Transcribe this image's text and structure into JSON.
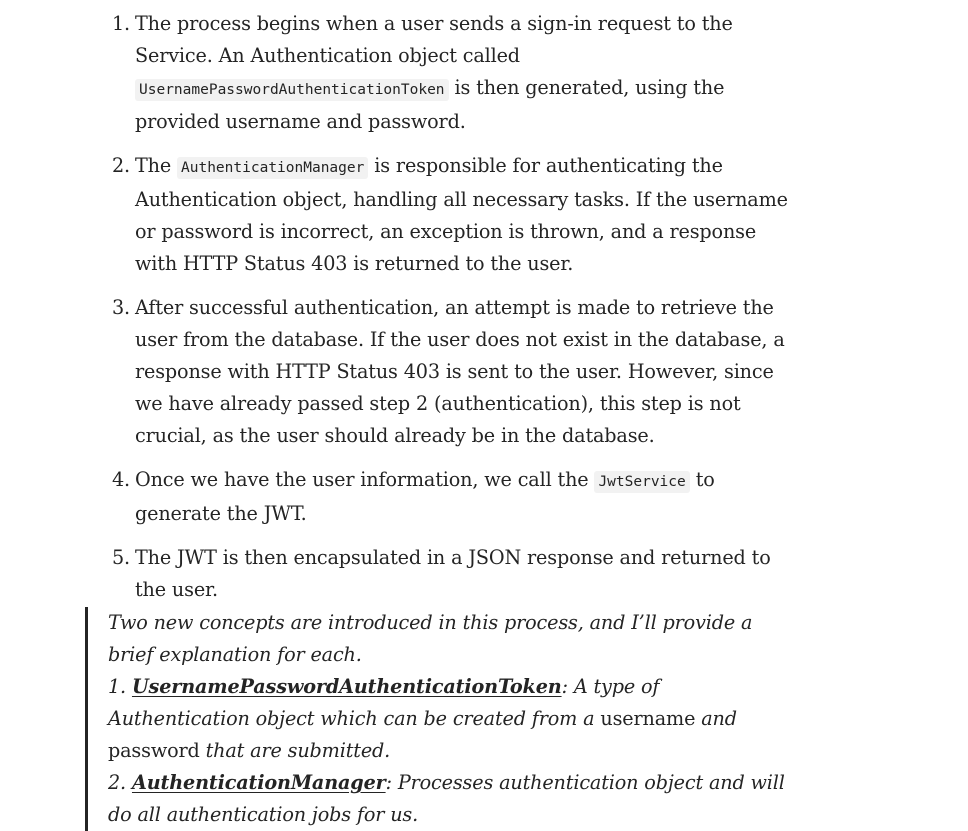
{
  "steps": [
    {
      "number": "1.",
      "text_1": "The process begins when a user sends a sign-in request to the Service. An Authentication object called ",
      "code_1": "UsernamePasswordAuthenticationToken",
      "text_2": " is then generated, using the provided username and password."
    },
    {
      "number": "2.",
      "text_1": "The ",
      "code_1": "AuthenticationManager",
      "text_2": " is responsible for authenticating the Authentication object, handling all necessary tasks. If the username or password is incorrect, an exception is thrown, and a response with HTTP Status 403 is returned to the user."
    },
    {
      "number": "3.",
      "text_1": "After successful authentication, an attempt is made to retrieve the user from the database. If the user does not exist in the database, a response with HTTP Status 403 is sent to the user. However, since we have already passed step 2 (authentication), this step is not crucial, as the user should already be in the database."
    },
    {
      "number": "4.",
      "text_1": "Once we have the user information, we call the ",
      "code_1": "JwtService",
      "text_2": " to generate the JWT."
    },
    {
      "number": "5.",
      "text_1": "The JWT is then encapsulated in a JSON response and returned to the user."
    }
  ],
  "quote": {
    "intro": "Two new concepts are introduced in this process, and I’ll provide a brief explanation for each.",
    "item1": {
      "number": "1. ",
      "term": "UsernamePasswordAuthenticationToken",
      "text_1": ": A type of Authentication object which can be created from a ",
      "plain_1": "username",
      "text_2": " and ",
      "plain_2": "password",
      "text_3": " that are submitted."
    },
    "item2": {
      "number": "2. ",
      "term": "AuthenticationManager",
      "text_1": ": Processes authentication object and will do all authentication jobs for us."
    }
  }
}
